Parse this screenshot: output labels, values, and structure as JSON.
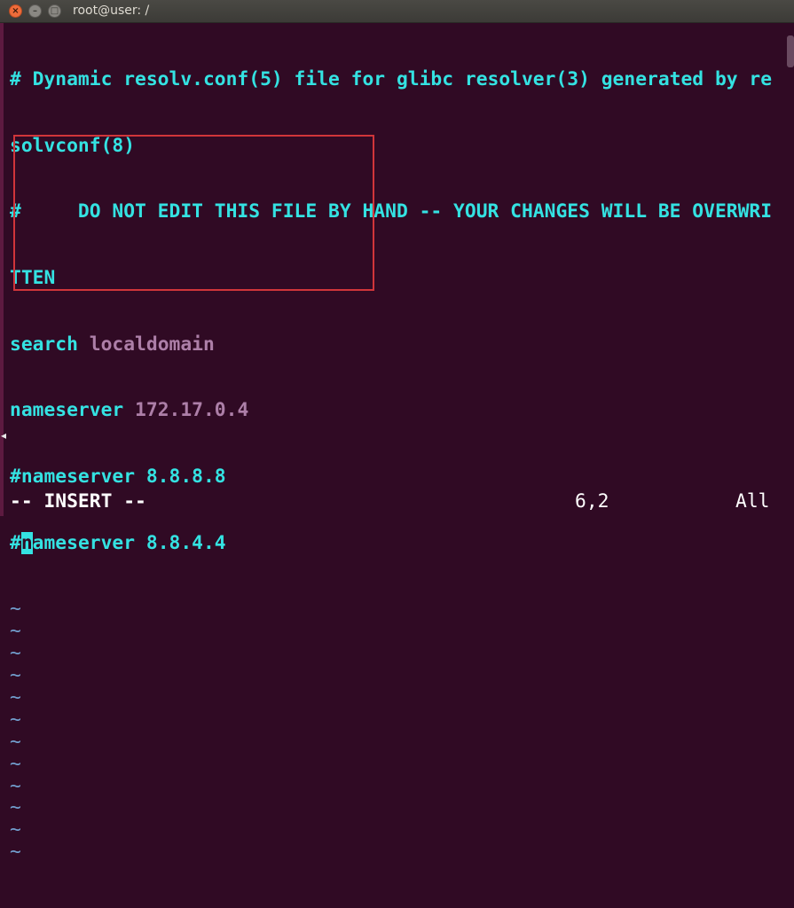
{
  "window": {
    "title": "root@user: /",
    "close_glyph": "×",
    "minimize_glyph": "–",
    "maximize_glyph": "□",
    "launcher_arrow_glyph": "◂"
  },
  "editor": {
    "lines": [
      {
        "kind": "comment",
        "text": "# Dynamic resolv.conf(5) file for glibc resolver(3) generated by re"
      },
      {
        "kind": "comment",
        "text": "solvconf(8)"
      },
      {
        "kind": "comment",
        "text": "#     DO NOT EDIT THIS FILE BY HAND -- YOUR CHANGES WILL BE OVERWRI"
      },
      {
        "kind": "comment",
        "text": "TTEN"
      },
      {
        "kind": "directive",
        "keyword": "search",
        "value": "localdomain"
      },
      {
        "kind": "directive",
        "keyword": "nameserver",
        "value": "172.17.0.4"
      },
      {
        "kind": "comment",
        "text": "#nameserver 8.8.8.8"
      },
      {
        "kind": "cursor_line",
        "before": "#",
        "cursor_char": "n",
        "after": "ameserver 8.8.4.4"
      }
    ],
    "tilde_char": "~",
    "tilde_count": 12
  },
  "status": {
    "mode": "-- INSERT --",
    "position": "6,2",
    "scroll": "All"
  },
  "colors": {
    "background": "#300a24",
    "comment": "#34e2e2",
    "value": "#ad7fa8",
    "tilde": "#729fcf",
    "annotation": "#d0353a"
  }
}
